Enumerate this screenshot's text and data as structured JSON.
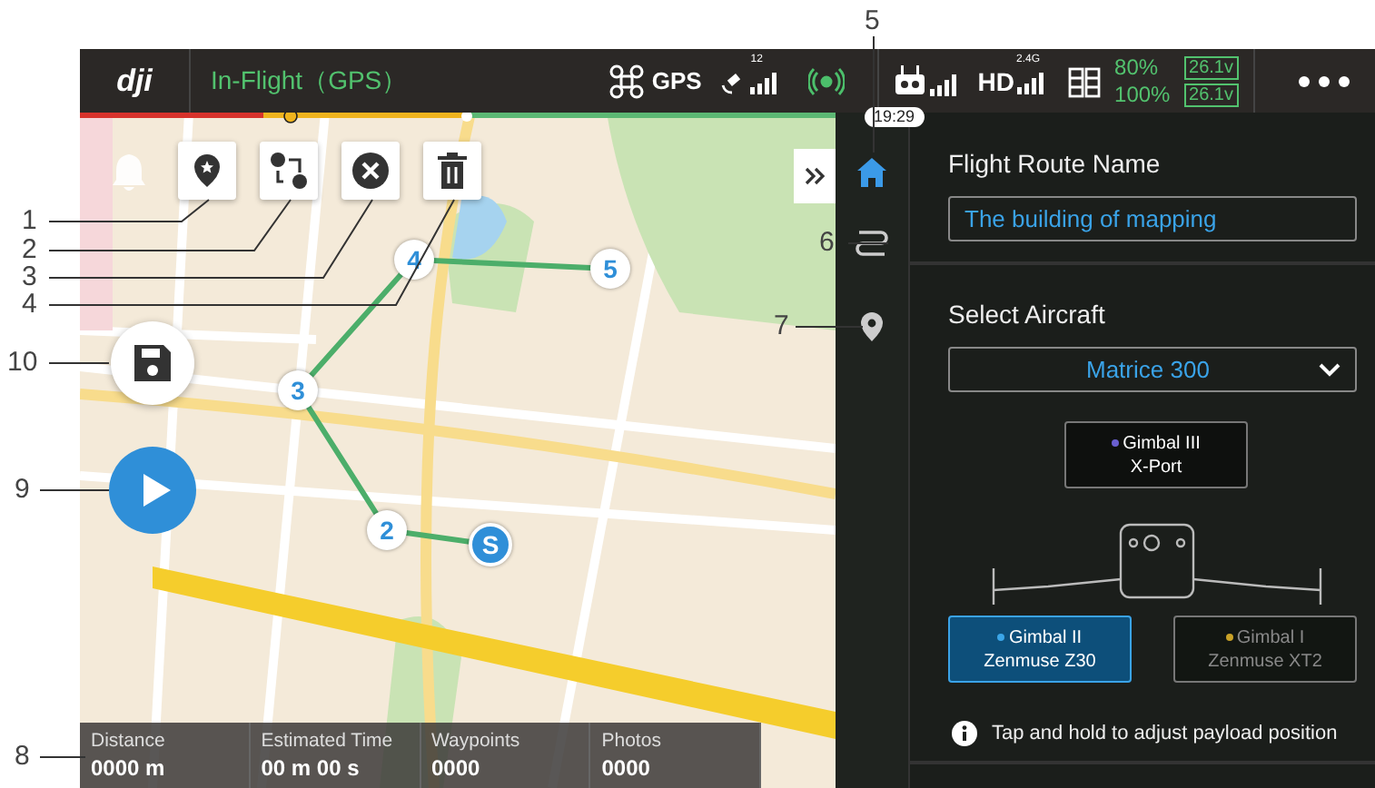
{
  "callouts": [
    {
      "label": "5"
    },
    {
      "label": "1"
    },
    {
      "label": "2"
    },
    {
      "label": "3"
    },
    {
      "label": "4"
    },
    {
      "label": "6"
    },
    {
      "label": "7"
    },
    {
      "label": "10"
    },
    {
      "label": "9"
    },
    {
      "label": "8"
    }
  ],
  "top_bar": {
    "logo": "dji",
    "flight_status": "In-Flight（GPS）",
    "gps_label": "GPS",
    "satellite_count": "12",
    "flight_time": "19:29",
    "hd_label": "HD",
    "hd_band": "2.4G",
    "batteries": [
      {
        "percent": "80%",
        "voltage": "26.1v"
      },
      {
        "percent": "100%",
        "voltage": "26.1v"
      }
    ]
  },
  "waypoints": [
    {
      "label": "4"
    },
    {
      "label": "5"
    },
    {
      "label": "3"
    },
    {
      "label": "2"
    }
  ],
  "start_marker": "S",
  "side_tabs": [
    {
      "kind": "home",
      "selected": true
    },
    {
      "kind": "route",
      "selected": false
    },
    {
      "kind": "pin",
      "selected": false
    }
  ],
  "panel": {
    "route_name_label": "Flight Route Name",
    "route_name_value": "The building of mapping",
    "aircraft_label": "Select Aircraft",
    "aircraft_value": "Matrice 300",
    "gimbals": [
      {
        "name": "Gimbal III",
        "payload": "X-Port",
        "color": "#6a5fd0",
        "selected": false,
        "disabled": false
      },
      {
        "name": "Gimbal II",
        "payload": "Zenmuse Z30",
        "color": "#3ba6e8",
        "selected": true,
        "disabled": false
      },
      {
        "name": "Gimbal I",
        "payload": "Zenmuse XT2",
        "color": "#c9a227",
        "selected": false,
        "disabled": true
      }
    ],
    "hint": "Tap and hold to adjust payload position"
  },
  "stats": [
    {
      "label": "Distance",
      "value": "0000 m"
    },
    {
      "label": "Estimated Time",
      "value": "00 m 00 s"
    },
    {
      "label": "Waypoints",
      "value": "0000"
    },
    {
      "label": "Photos",
      "value": "0000"
    }
  ]
}
